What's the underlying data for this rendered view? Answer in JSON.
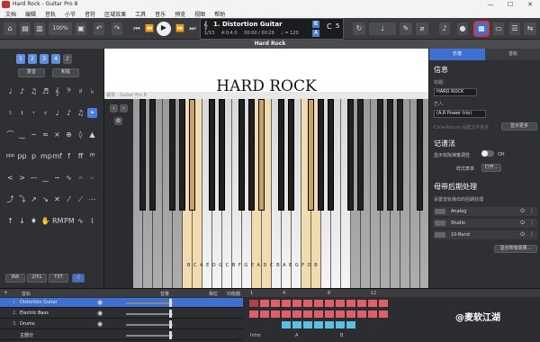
{
  "window": {
    "title": "Hard Rock - Guitar Pro 8",
    "controls": [
      "—",
      "☐",
      "✕"
    ]
  },
  "menu": [
    "文档",
    "编辑",
    "音轨",
    "小节",
    "音符",
    "区域效果",
    "工具",
    "音乐",
    "预览",
    "视图",
    "帮助"
  ],
  "toolbar": {
    "zoom": "100%",
    "undo": "↶",
    "redo": "↷"
  },
  "transport": {
    "track_name": "1. Distortion Guitar",
    "bar": "1/13",
    "time_sig": "4:0:4.0",
    "time": "00:00 / 00:29",
    "tempo": "♩ = 120",
    "key": "C",
    "key_num": "5"
  },
  "doc": {
    "tab_title": "Hard Rock"
  },
  "left_panel": {
    "voices": [
      "1",
      "2",
      "3",
      "4"
    ],
    "voice_buttons": [
      "复音",
      "和弦"
    ],
    "bottom_buttons": [
      "BW",
      "2/51",
      "TXT"
    ]
  },
  "score": {
    "title": "HARD ROCK"
  },
  "piano": {
    "window_title": "钢琴 - Guitar Pro 8",
    "note_letters": "B C A E D G C B F G E A D C B A E G F D B"
  },
  "right_panel": {
    "tabs": [
      "乐谱",
      "音轨"
    ],
    "info_heading": "信息",
    "title_label": "标题:",
    "title_value": "HARD ROCK",
    "artist_label": "艺人:",
    "artist_value": "(A.R Power trio)",
    "shortcut_hint": "Ctrl+Return 设置文件信息",
    "more_button": "显示更多",
    "notation_heading": "记谱法",
    "notation_toggle_label": "显示实际演奏调性",
    "toggle_state": "Off",
    "style_label": "样式表单",
    "open_button": "打开...",
    "mastering_heading": "母带后期处理",
    "mastering_sub": "设置音轨输出的后期处理",
    "fx": [
      "Analog",
      "Studio",
      "10-Band"
    ],
    "all_fx_button": "显示所有效果..."
  },
  "tracks": {
    "header": {
      "track": "音轨",
      "volume": "音量",
      "pan": "相位",
      "eq": "均衡器"
    },
    "rows": [
      {
        "num": "1.",
        "name": "Distortion Guitar"
      },
      {
        "num": "2.",
        "name": "Electric Bass"
      },
      {
        "num": "3.",
        "name": "Drums"
      },
      {
        "num": "",
        "name": "主部分"
      }
    ],
    "bar_numbers": [
      "1",
      "4",
      "8",
      "12"
    ],
    "sections": [
      "Intro",
      "A",
      "B"
    ]
  },
  "watermark": "@麦软江湖",
  "colors": {
    "accent": "#3e70d0",
    "highlight_key": "#f1dcae",
    "track_red": "#e0606a",
    "track_blue": "#5bc0e0",
    "marker": "#e03030"
  }
}
